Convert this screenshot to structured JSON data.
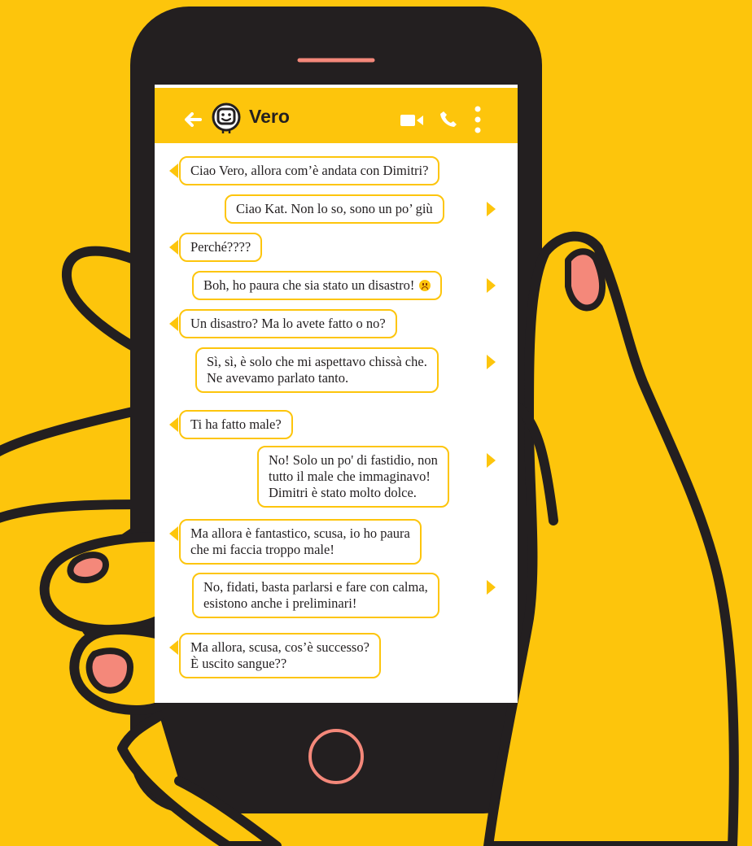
{
  "colors": {
    "background": "#fdc50c",
    "phone_body": "#231f20",
    "accent": "#f4887a",
    "bubble_border": "#fdc50c"
  },
  "header": {
    "contact_name": "Vero",
    "icons": [
      "back-arrow-icon",
      "bot-avatar-icon",
      "video-call-icon",
      "phone-icon",
      "more-vertical-icon"
    ]
  },
  "messages": [
    {
      "side": "incoming",
      "lines": [
        "Ciao Vero, allora com’è andata con Dimitri?"
      ]
    },
    {
      "side": "outgoing",
      "lines": [
        "Ciao Kat. Non lo so, sono un po’ giù"
      ]
    },
    {
      "side": "incoming",
      "lines": [
        "Perché????"
      ]
    },
    {
      "side": "outgoing",
      "lines": [
        "Boh, ho paura che sia stato un disastro!"
      ],
      "emoji": "sad-face"
    },
    {
      "side": "incoming",
      "lines": [
        "Un disastro? Ma lo avete fatto o no?"
      ]
    },
    {
      "side": "outgoing",
      "lines": [
        "Sì, sì, è solo che  mi aspettavo chissà che.",
        "Ne avevamo parlato tanto."
      ]
    },
    {
      "side": "incoming",
      "lines": [
        "Ti ha fatto male?"
      ]
    },
    {
      "side": "outgoing",
      "lines": [
        "No! Solo un po' di fastidio, non",
        "tutto il male che immaginavo!",
        "Dimitri è stato molto dolce."
      ]
    },
    {
      "side": "incoming",
      "lines": [
        "Ma allora è fantastico, scusa, io ho paura",
        "che mi faccia troppo male!"
      ]
    },
    {
      "side": "outgoing",
      "lines": [
        "No, fidati, basta parlarsi e fare con calma,",
        "esistono anche i preliminari!"
      ]
    },
    {
      "side": "incoming",
      "lines": [
        "Ma allora, scusa, cos’è successo?",
        "È uscito sangue??"
      ]
    }
  ]
}
